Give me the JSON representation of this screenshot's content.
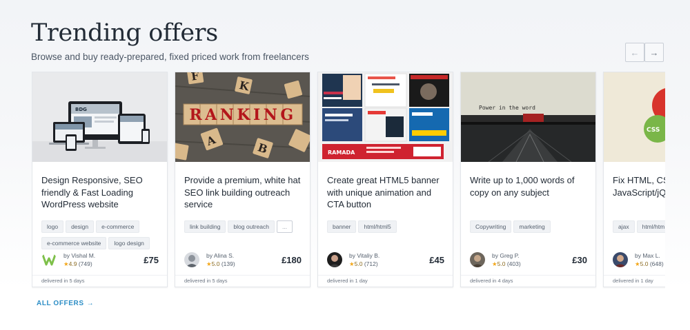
{
  "header": {
    "title": "Trending offers",
    "subtitle": "Browse and buy ready-prepared, fixed priced work from freelancers",
    "prev_icon": "←",
    "next_icon": "→"
  },
  "cards": [
    {
      "title": "Design Responsive, SEO friendly & Fast Loading WordPress website",
      "tags": [
        "logo",
        "design",
        "e-commerce",
        "e-commerce website",
        "logo design"
      ],
      "author": "by Vishal M.",
      "rating": "4.9",
      "reviews": "(749)",
      "price": "£75",
      "delivery": "delivered in 5 days",
      "thumb_text": "BDG"
    },
    {
      "title": "Provide a premium, white hat SEO link building outreach service",
      "tags": [
        "link building",
        "blog outreach",
        "..."
      ],
      "author": "by Alina S.",
      "rating": "5.0",
      "reviews": "(139)",
      "price": "£180",
      "delivery": "delivered in 5 days",
      "thumb_text": "RANKING",
      "thumb_letters": [
        "F",
        "K",
        "A",
        "B"
      ]
    },
    {
      "title": "Create great HTML5 banner with unique animation and CTA button",
      "tags": [
        "banner",
        "html/html5"
      ],
      "author": "by Vitaliy B.",
      "rating": "5.0",
      "reviews": "(712)",
      "price": "£45",
      "delivery": "delivered in 1 day",
      "thumb_text": "RAMADA"
    },
    {
      "title": "Write up to 1,000 words of copy on any subject",
      "tags": [
        "Copywriting",
        "marketing"
      ],
      "author": "by Greg P.",
      "rating": "5.0",
      "reviews": "(403)",
      "price": "£30",
      "delivery": "delivered in 4 days",
      "thumb_text": "Power in the word"
    },
    {
      "title": "Fix HTML, CSS JavaScript/jQu bugs/errors",
      "tags": [
        "ajax",
        "html/htm"
      ],
      "author": "by Max L.",
      "rating": "5.0",
      "reviews": "(648)",
      "price": "",
      "delivery": "delivered in 1 day",
      "thumb_text": "CSS"
    }
  ],
  "footer": {
    "all_offers": "ALL OFFERS",
    "arrow": "→"
  },
  "colors": {
    "accent": "#2d8ec6",
    "star": "#f3a71a",
    "title": "#222b36"
  }
}
